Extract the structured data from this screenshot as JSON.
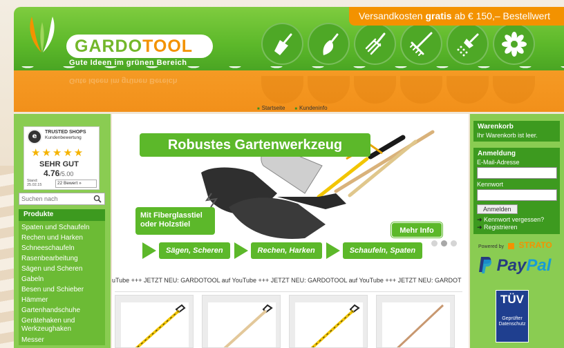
{
  "shipping": {
    "prefix": "Versandkosten",
    "bold": "gratis",
    "suffix": "ab € 150,– Bestellwert"
  },
  "logo": {
    "part1": "GARDO",
    "part2": "TOOL",
    "tagline": "Gute Ideen im grünen Bereich"
  },
  "tool_icons": [
    "spade-icon",
    "trowel-icon",
    "fork-icon",
    "rake-icon",
    "shower-icon",
    "flower-icon"
  ],
  "breadcrumb": [
    "Startseite",
    "Kundeninfo"
  ],
  "trusted_shops": {
    "title": "TRUSTED SHOPS",
    "subtitle": "Kundenbewertung",
    "stars": "★★★★★",
    "rating_text": "SEHR GUT",
    "score": "4.76",
    "score_max": "/5.00",
    "stand": "Stand:",
    "date": "25.02.15",
    "reviews": "22 Bewert"
  },
  "search": {
    "placeholder": "Suchen nach"
  },
  "categories": {
    "heading": "Produkte",
    "items": [
      "Spaten und Schaufeln",
      "Rechen und Harken",
      "Schneeschaufeln",
      "Rasenbearbeitung",
      "Sägen und Scheren",
      "Gabeln",
      "Besen und Schieber",
      "Hämmer",
      "Gartenhandschuhe",
      "Gerätehaken und Werkzeughaken",
      "Messer"
    ]
  },
  "slider": {
    "title": "Robustes Gartenwerkzeug",
    "subtitle_line1": "Mit Fiberglasstiel",
    "subtitle_line2": "oder Holzstiel",
    "more_button": "Mehr Info",
    "active_dot": 1
  },
  "features": [
    "Sägen, Scheren",
    "Rechen, Harken",
    "Schaufeln, Spaten"
  ],
  "ticker": "uTube +++ JETZT NEU: GARDOTOOL auf YouTube +++ JETZT NEU: GARDOTOOL auf YouTube +++ JETZT NEU: GARDOT",
  "cart": {
    "title": "Warenkorb",
    "status": "Ihr Warenkorb ist leer."
  },
  "login": {
    "title": "Anmeldung",
    "email_label": "E-Mail-Adresse",
    "password_label": "Kennwort",
    "submit": "Anmelden",
    "forgot": "Kennwort vergessen?",
    "register": "Registrieren"
  },
  "powered": {
    "label": "Powered by",
    "brand": "STRATO"
  },
  "paypal": {
    "part1": "Pay",
    "part2": "Pal"
  },
  "tuv": {
    "title": "TÜV",
    "line1": "Geprüfter",
    "line2": "Datenschutz"
  },
  "colors": {
    "green": "#5cb82a",
    "dark_green": "#3d9a1f",
    "orange": "#f39200"
  }
}
